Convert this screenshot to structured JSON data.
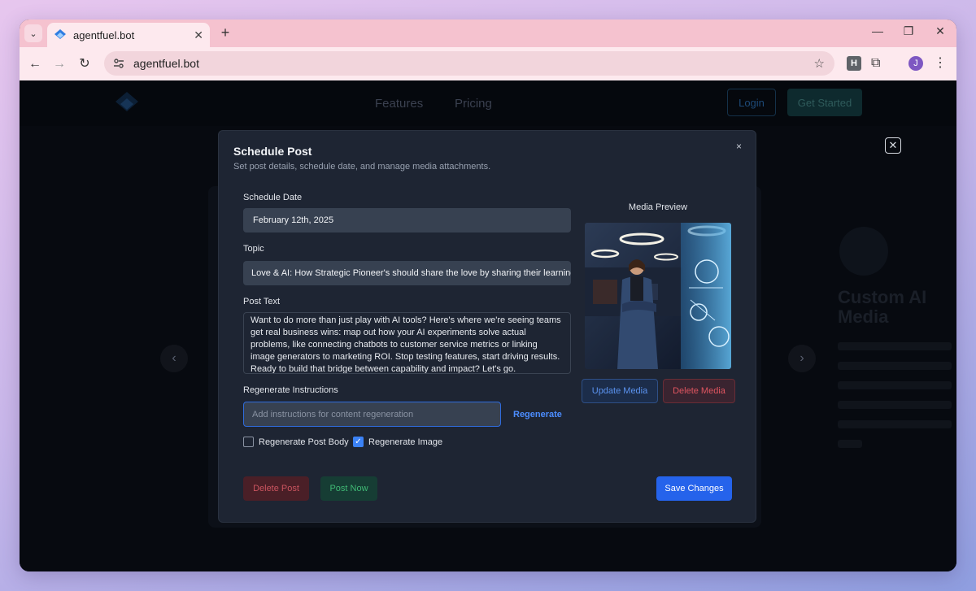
{
  "browser": {
    "tab_title": "agentfuel.bot",
    "tab_close": "✕",
    "new_tab": "+",
    "url": "agentfuel.bot",
    "extension_h": "H",
    "profile_initial": "J"
  },
  "site": {
    "nav": {
      "features": "Features",
      "pricing": "Pricing",
      "login": "Login",
      "get_started": "Get Started"
    },
    "side_title": "Custom AI Media"
  },
  "modal": {
    "title": "Schedule Post",
    "subtitle": "Set post details, schedule date, and manage media attachments.",
    "close_glyph": "×",
    "schedule_date_label": "Schedule Date",
    "schedule_date_value": "February 12th, 2025",
    "topic_label": "Topic",
    "topic_value": "Love & AI: How Strategic Pioneer's should share the love by sharing their learnings",
    "post_text_label": "Post Text",
    "post_text_value": "Want to do more than just play with AI tools? Here's where we're seeing teams get real business wins: map out how your AI experiments solve actual problems, like connecting chatbots to customer service metrics or linking image generators to marketing ROI. Stop testing features, start driving results. Ready to build that bridge between capability and impact? Let's go.",
    "regen_label": "Regenerate Instructions",
    "regen_placeholder": "Add instructions for content regeneration",
    "regen_button": "Regenerate",
    "regen_post_body": "Regenerate Post Body",
    "regen_post_body_checked": false,
    "regen_image": "Regenerate Image",
    "regen_image_checked": true,
    "media_preview_label": "Media Preview",
    "update_media": "Update Media",
    "delete_media": "Delete Media",
    "delete_post": "Delete Post",
    "post_now": "Post Now",
    "save_changes": "Save Changes"
  },
  "colors": {
    "accent": "#2563eb",
    "danger": "#e05560",
    "success": "#3fb874"
  }
}
